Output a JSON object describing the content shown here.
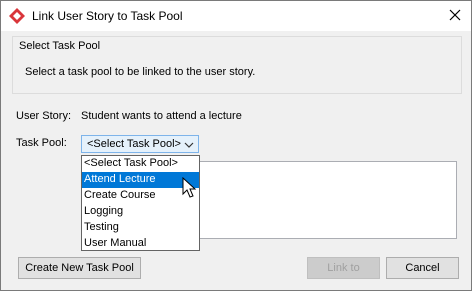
{
  "window": {
    "title": "Link User Story to Task Pool",
    "accent_color": "#d9353a"
  },
  "group": {
    "title": "Select Task Pool",
    "description": "Select a task pool to be linked to the user story."
  },
  "form": {
    "user_story_label": "User Story:",
    "user_story_value": "Student wants to attend a lecture",
    "task_pool_label": "Task Pool:",
    "task_pool_selected": "<Select Task Pool>"
  },
  "dropdown": {
    "options": [
      "<Select Task Pool>",
      "Attend Lecture",
      "Create Course",
      "Logging",
      "Testing",
      "User Manual"
    ],
    "highlighted": "Attend Lecture",
    "highlight_color": "#0078d7"
  },
  "buttons": {
    "create_new": "Create New Task Pool",
    "link_to": "Link to",
    "cancel": "Cancel"
  }
}
